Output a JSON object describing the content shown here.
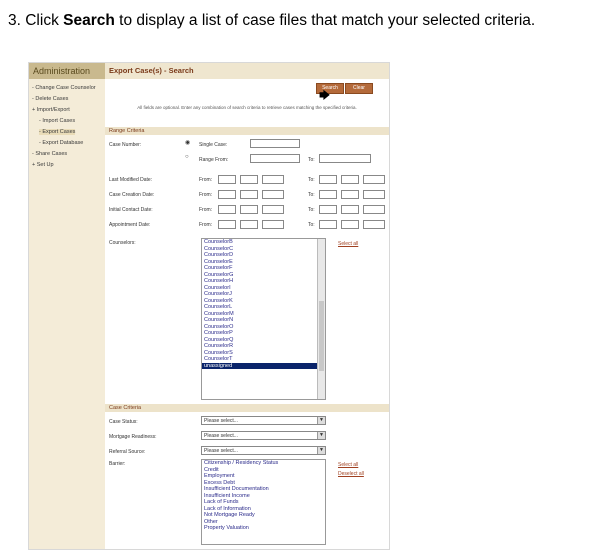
{
  "instruction": {
    "prefix": "3. Click ",
    "bold": "Search",
    "suffix": " to display a list of case files that match your selected criteria."
  },
  "sidebar": {
    "title": "Administration",
    "items": [
      "- Change Case Counselor",
      "- Delete Cases",
      "+ Import/Export",
      "- Import Cases",
      "- Export Cases",
      "- Export Database",
      "- Share Cases",
      "+ Set Up"
    ]
  },
  "main": {
    "title": "Export Case(s) - Search",
    "search_label": "Search",
    "clear_label": "Clear",
    "note": "All fields are optional. Enter any combination of search criteria to retrieve cases matching the specified criteria.",
    "range_title": "Range Criteria",
    "case_number_label": "Case Number:",
    "single_case_label": "Single Case:",
    "range_from_label": "Range From:",
    "to_label": "To:",
    "from_label": "From:",
    "date_rows": [
      "Last Modified Date:",
      "Case Creation Date:",
      "Initial Contact Date:",
      "Appointment Date:"
    ],
    "counselors_label": "Counselors:",
    "select_all": "Select all",
    "counselors": [
      "CounselorB",
      "CounselorC",
      "CounselorD",
      "CounselorE",
      "CounselorF",
      "CounselorG",
      "CounselorH",
      "CounselorI",
      "CounselorJ",
      "CounselorK",
      "CounselorL",
      "CounselorM",
      "CounselorN",
      "CounselorO",
      "CounselorP",
      "CounselorQ",
      "CounselorR",
      "CounselorS",
      "CounselorT",
      "unassigned"
    ],
    "case_criteria_title": "Case Criteria",
    "case_status_label": "Case Status:",
    "mortgage_label": "Mortgage Readiness:",
    "referral_label": "Referral Source:",
    "barrier_label": "Barrier:",
    "please_select": "Please select...",
    "barrier_select_all": "Select all",
    "barrier_deselect_all": "Deselect all",
    "barriers": [
      "Citizenship / Residency Status",
      "Credit",
      "Employment",
      "Excess Debt",
      "Insufficient Documentation",
      "Insufficient Income",
      "Lack of Funds",
      "Lack of Information",
      "Not Mortgage Ready",
      "Other",
      "Property Valuation"
    ]
  },
  "colors": {
    "accent": "#b46a3a",
    "sidebar_bg": "#f4ecd8",
    "section_bg": "#ede3ca",
    "selection": "#0a246a"
  }
}
